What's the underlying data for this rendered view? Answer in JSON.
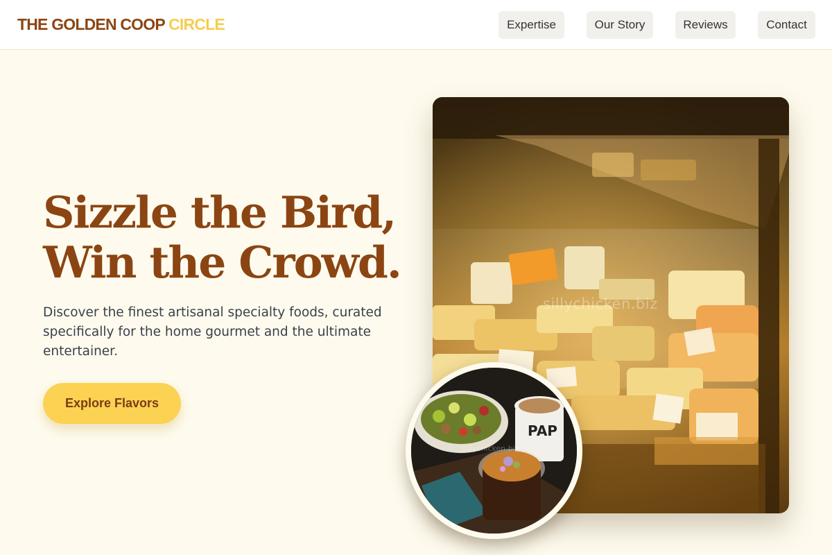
{
  "header": {
    "logo_main": "THE GOLDEN COOP",
    "logo_accent": "CIRCLE",
    "nav": {
      "expertise": "Expertise",
      "story": "Our Story",
      "reviews": "Reviews",
      "contact": "Contact"
    }
  },
  "hero": {
    "title_line1": "Sizzle the Bird,",
    "title_line2": "Win the Crowd.",
    "subtitle": "Discover the finest artisanal specialty foods, curated specifically for the home gourmet and the ultimate entertainer.",
    "cta_label": "Explore Flavors"
  },
  "images": {
    "main_watermark": "sillychicken.biz",
    "circle_watermark": "sillychicken.biz",
    "cup_text": "PAP"
  },
  "colors": {
    "brand": "#8b4513",
    "accent": "#f5cd52",
    "background": "#fefbee",
    "cta": "#fcd253"
  }
}
